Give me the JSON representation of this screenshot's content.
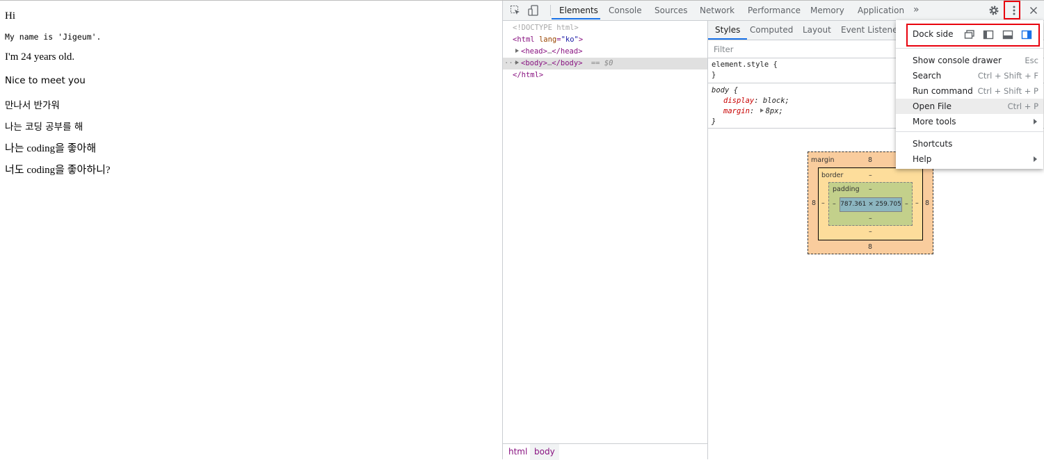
{
  "page": {
    "lines": [
      "Hi",
      "My name is 'Jigeum'.",
      "I'm 24 years old.",
      "Nice to meet you",
      "만나서 반가워",
      "나는 코딩 공부를 해",
      "나는 coding을 좋아해",
      "너도 coding을 좋아하니?"
    ]
  },
  "devtools": {
    "tabs": [
      "Elements",
      "Console",
      "Sources",
      "Network",
      "Performance",
      "Memory",
      "Application"
    ],
    "active_tab": "Elements",
    "more_tabs": "»",
    "dom": {
      "doctype": "<!DOCTYPE html>",
      "html_open_tag": "<html",
      "html_attr": "lang",
      "html_attr_value": "\"ko\"",
      "head_open": "<head>",
      "ellipsis": "…",
      "head_close": "</head>",
      "body_open": "<body>",
      "body_close": "</body>",
      "selected_marker": "== $0",
      "dots": "···",
      "html_close": "</html>"
    },
    "breadcrumb": [
      "html",
      "body"
    ],
    "styles_tabs": [
      "Styles",
      "Computed",
      "Layout",
      "Event Listeners"
    ],
    "filter_placeholder": "Filter",
    "rules": {
      "element_style": "element.style {",
      "close_brace": "}",
      "body_selector": "body {",
      "display_prop": "display",
      "display_val": "block;",
      "margin_prop": "margin",
      "margin_val": "8px;"
    },
    "box_model": {
      "margin_label": "margin",
      "border_label": "border",
      "padding_label": "padding",
      "margin_top": "8",
      "margin_bottom": "8",
      "margin_left": "8",
      "margin_right": "8",
      "border_top": "–",
      "border_bottom": "–",
      "border_left": "–",
      "border_right": "–",
      "padding_top": "–",
      "padding_bottom": "–",
      "padding_left": "–",
      "padding_right": "–",
      "content_size": "787.361 × 259.705"
    },
    "menu": {
      "dock_side_label": "Dock side",
      "items": [
        {
          "label": "Show console drawer",
          "shortcut": "Esc"
        },
        {
          "label": "Search",
          "shortcut": "Ctrl + Shift + F"
        },
        {
          "label": "Run command",
          "shortcut": "Ctrl + Shift + P"
        },
        {
          "label": "Open File",
          "shortcut": "Ctrl + P"
        },
        {
          "label": "More tools",
          "shortcut": ""
        }
      ],
      "items2": [
        {
          "label": "Shortcuts",
          "shortcut": ""
        },
        {
          "label": "Help",
          "shortcut": ""
        }
      ]
    },
    "colors": {
      "accent": "#1a73e8",
      "highlight_red": "#e8000d",
      "margin_fill": "#f9cc9d",
      "border_fill": "#fddd9b",
      "padding_fill": "#c3d08b",
      "content_fill": "#8cb6c0"
    },
    "icons": [
      "inspect-element-icon",
      "device-toolbar-icon",
      "settings-gear-icon",
      "kebab-menu-icon",
      "close-icon",
      "undock-icon",
      "dock-left-icon",
      "dock-bottom-icon",
      "dock-right-icon",
      "submenu-arrow-icon"
    ]
  }
}
